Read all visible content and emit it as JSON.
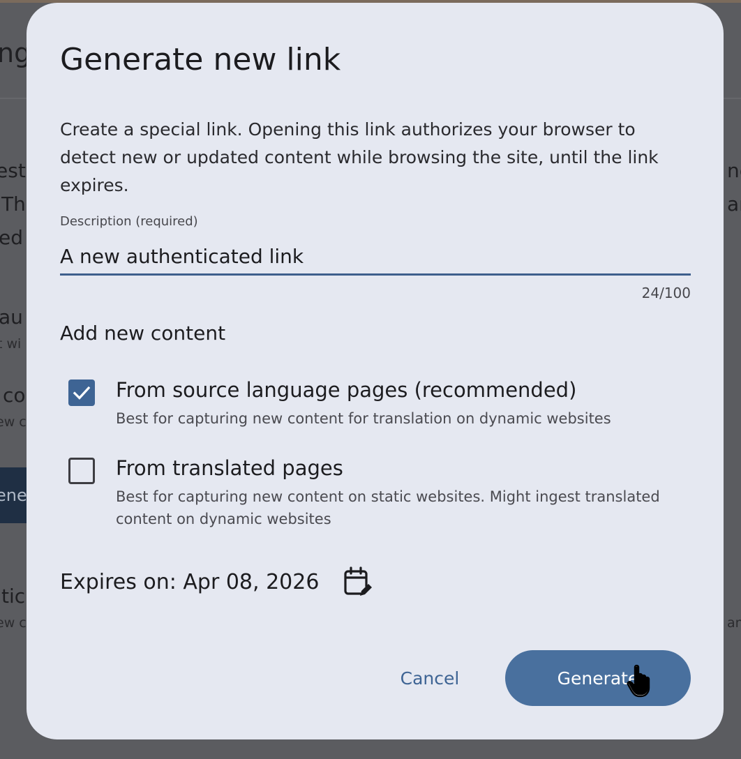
{
  "background": {
    "fragments": {
      "f1": "ng",
      "f2": "est",
      "f3": "Th",
      "f4": "ed l",
      "f5": "au",
      "f6": "t wi",
      "f7": "co",
      "f8": "ew c",
      "f9": "tic",
      "f10": "ew c",
      "f11": "ne",
      "f12": "an",
      "f13": "an"
    },
    "button_fragment": "ene"
  },
  "dialog": {
    "title": "Generate new link",
    "description": "Create a special link. Opening this link authorizes your browser to detect new or updated content while browsing the site, until the link expires.",
    "field": {
      "label": "Description (required)",
      "value": "A new authenticated link",
      "counter": "24/100"
    },
    "section_heading": "Add new content",
    "options": [
      {
        "label": "From source language pages (recommended)",
        "help": "Best for capturing new content for translation on dynamic websites",
        "checked": true
      },
      {
        "label": "From translated pages",
        "help": "Best for capturing new content on static websites. Might ingest translated content on dynamic websites",
        "checked": false
      }
    ],
    "expires": "Expires on: Apr 08, 2026",
    "calendar_icon": "calendar-edit-icon",
    "cancel_label": "Cancel",
    "generate_label": "Generate"
  },
  "colors": {
    "accent": "#49709e",
    "checkbox_checked": "#3e6494",
    "dialog_bg": "#e5e8f1",
    "overlay_bg": "#5b5c60"
  }
}
